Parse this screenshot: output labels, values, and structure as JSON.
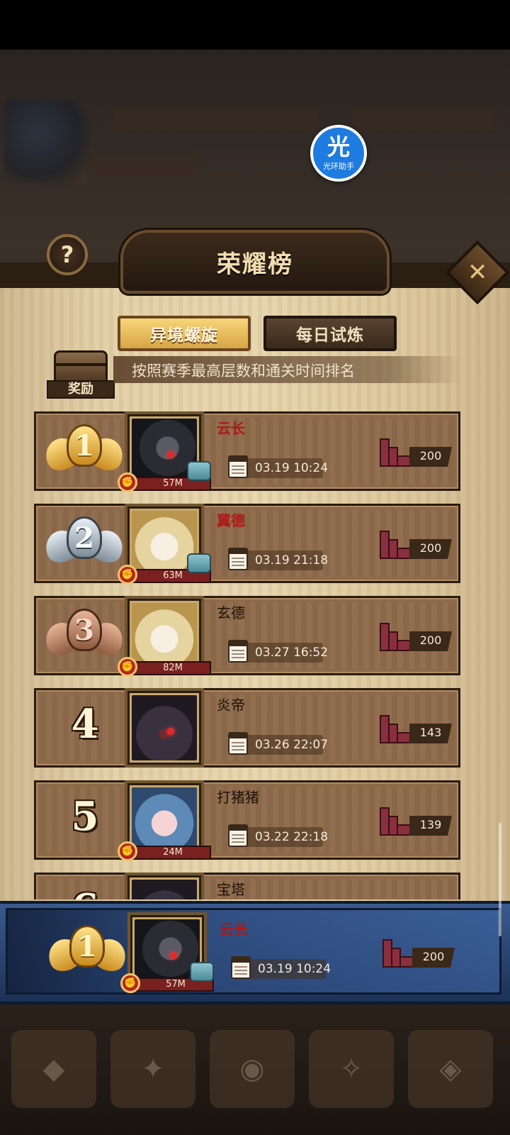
{
  "header": {
    "title": "荣耀榜"
  },
  "helper": {
    "glyph": "光",
    "label": "光环助手"
  },
  "tabs": [
    {
      "label": "异境螺旋",
      "active": true
    },
    {
      "label": "每日试炼",
      "active": false
    }
  ],
  "reward": {
    "label": "奖励"
  },
  "subtitle": "按照赛季最高层数和通关时间排名",
  "rows": [
    {
      "rank": "1",
      "medal": "gold",
      "name": "云长",
      "name_color": "red",
      "power": "57M",
      "date": "03.19 10:24",
      "floors": "200"
    },
    {
      "rank": "2",
      "medal": "silver",
      "name": "翼德",
      "name_color": "red",
      "power": "63M",
      "date": "03.19 21:18",
      "floors": "200"
    },
    {
      "rank": "3",
      "medal": "bronze",
      "name": "玄德",
      "name_color": "dark",
      "power": "82M",
      "date": "03.27 16:52",
      "floors": "200"
    },
    {
      "rank": "4",
      "medal": "none",
      "name": "炎帝",
      "name_color": "dark",
      "power": "",
      "date": "03.26 22:07",
      "floors": "143"
    },
    {
      "rank": "5",
      "medal": "none",
      "name": "打猪猪",
      "name_color": "dark",
      "power": "24M",
      "date": "03.22 22:18",
      "floors": "139"
    },
    {
      "rank": "6",
      "medal": "none",
      "name": "宝塔",
      "name_color": "dark",
      "power": "",
      "date": "",
      "floors": ""
    }
  ],
  "my_rank": {
    "rank": "1",
    "medal": "gold",
    "name": "云长",
    "power": "57M",
    "date": "03.19 10:24",
    "floors": "200"
  },
  "icons": {
    "help": "?",
    "close": "✕",
    "fist": "✊"
  },
  "colors": {
    "panel": "#e2cfa6",
    "row": "#8e6a4a",
    "my_bar": "#2e4c7e",
    "name_red": "#b01818",
    "helper_blue": "#1e7be0"
  }
}
